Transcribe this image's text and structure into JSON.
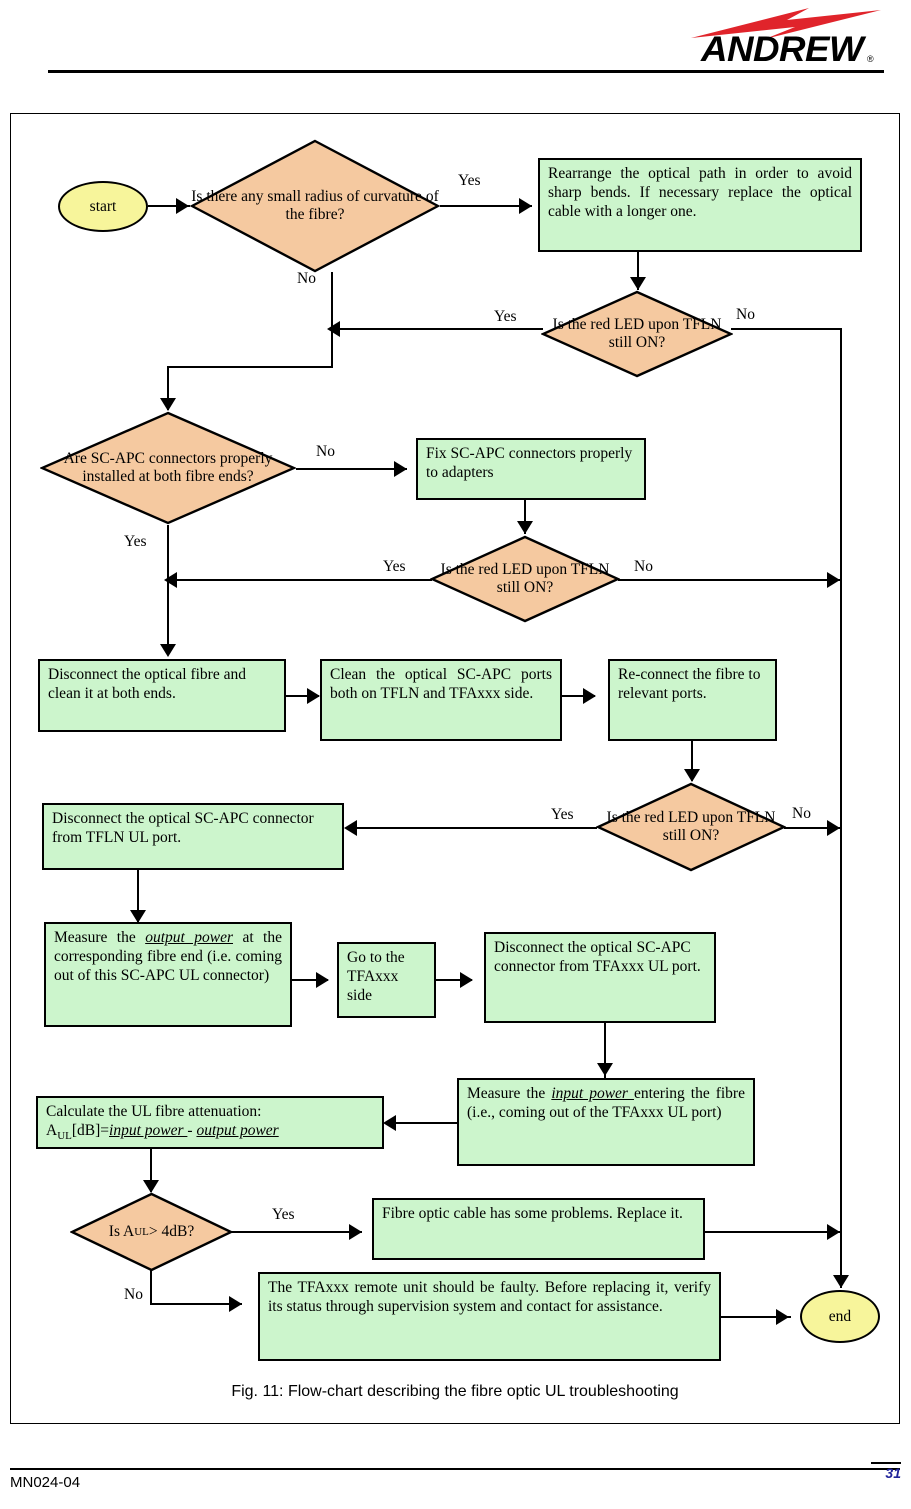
{
  "header": {
    "brand": "ANDREW",
    "registered_mark": "®"
  },
  "figure": {
    "caption": "Fig. 11: Flow-chart describing the fibre optic UL troubleshooting"
  },
  "footer": {
    "document_number": "MN024-04",
    "page_number": "31"
  },
  "colors": {
    "decision_fill": "#F5C9A0",
    "process_fill": "#CCF5CC",
    "terminator_fill": "#F7F59B",
    "stroke": "#000000",
    "page_number": "#21249B"
  },
  "flowchart": {
    "type": "flowchart",
    "title": "Fibre optic UL troubleshooting",
    "nodes": {
      "start": {
        "kind": "terminator",
        "label": "start"
      },
      "d1": {
        "kind": "decision",
        "label": "Is there any small radius of curvature of the fibre?"
      },
      "p1": {
        "kind": "process",
        "label": "Rearrange the optical path in order to avoid sharp bends. If necessary replace the optical cable with a longer one."
      },
      "d2": {
        "kind": "decision",
        "label": "Is the red LED upon TFLN still ON?"
      },
      "d3": {
        "kind": "decision",
        "label": "Are SC-APC connectors properly installed at both fibre ends?"
      },
      "p2": {
        "kind": "process",
        "label": "Fix  SC-APC  connectors properly to adapters"
      },
      "d4": {
        "kind": "decision",
        "label": "Is the red LED upon TFLN still ON?"
      },
      "p3": {
        "kind": "process",
        "label": "Disconnect the optical fibre and clean it at both ends."
      },
      "p4": {
        "kind": "process",
        "label": "Clean the optical SC-APC ports both on TFLN and TFAxxx side."
      },
      "p5": {
        "kind": "process",
        "label": "Re-connect the fibre to relevant ports."
      },
      "d5": {
        "kind": "decision",
        "label": "Is the red LED upon TFLN still ON?"
      },
      "p6": {
        "kind": "process",
        "label": "Disconnect the optical SC-APC connector from TFLN UL port."
      },
      "p7": {
        "kind": "process",
        "label_parts": [
          "Measure  the  ",
          "output  power",
          " at  the  corresponding  fibre end (i.e. coming out of this SC-APC UL connector)"
        ],
        "emphasis": "output  power"
      },
      "p8": {
        "kind": "process",
        "label": "Go to the TFAxxx side"
      },
      "p9": {
        "kind": "process",
        "label": "Disconnect the optical SC-APC connector from TFAxxx UL port."
      },
      "p10": {
        "kind": "process",
        "label_parts": [
          "Measure the ",
          "input power ",
          "entering the fibre (i.e., coming out of the TFAxxx UL port)"
        ],
        "emphasis": "input power "
      },
      "p11": {
        "kind": "process",
        "line1": "Calculate the UL fibre attenuation:",
        "formula_prefix": "A",
        "formula_subscript": "UL",
        "formula_mid": "[dB]=",
        "formula_term1": "input power ",
        "formula_op": " - ",
        "formula_term2": "output power"
      },
      "d6": {
        "kind": "decision",
        "label_prefix": "Is A",
        "label_subscript": "UL",
        "label_suffix": " > 4dB?"
      },
      "p12": {
        "kind": "process",
        "label": "Fibre optic cable has some problems. Replace it."
      },
      "p13": {
        "kind": "process",
        "label": "The TFAxxx remote unit should be faulty. Before replacing it, verify its status through supervision system and contact for assistance."
      },
      "end": {
        "kind": "terminator",
        "label": "end"
      }
    },
    "edge_labels": {
      "d1_yes": "Yes",
      "d1_no": "No",
      "d2_yes": "Yes",
      "d2_no": "No",
      "d3_no": "No",
      "d3_yes": "Yes",
      "d4_yes": "Yes",
      "d4_no": "No",
      "d5_yes": "Yes",
      "d5_no": "No",
      "d6_yes": "Yes",
      "d6_no": "No"
    }
  }
}
